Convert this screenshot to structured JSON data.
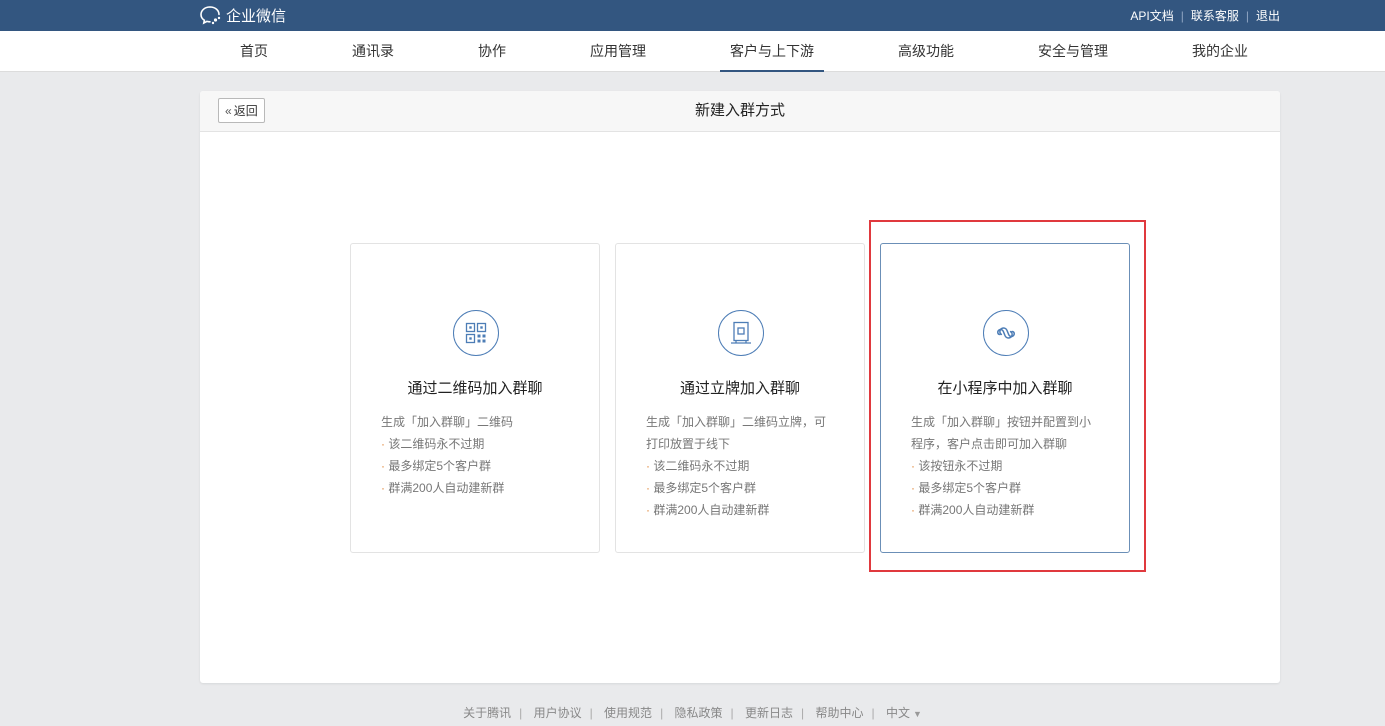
{
  "header": {
    "app_name": "企业微信",
    "links": [
      "API文档",
      "联系客服",
      "退出"
    ]
  },
  "nav": {
    "items": [
      "首页",
      "通讯录",
      "协作",
      "应用管理",
      "客户与上下游",
      "高级功能",
      "安全与管理",
      "我的企业"
    ],
    "active": "客户与上下游"
  },
  "panel": {
    "back_label": "返回",
    "title": "新建入群方式"
  },
  "cards": [
    {
      "title": "通过二维码加入群聊",
      "intro": [
        "生成「加入群聊」二维码"
      ],
      "bullets": [
        "该二维码永不过期",
        "最多绑定5个客户群",
        "群满200人自动建新群"
      ]
    },
    {
      "title": "通过立牌加入群聊",
      "intro": [
        "生成「加入群聊」二维码立牌，可",
        "打印放置于线下"
      ],
      "bullets": [
        "该二维码永不过期",
        "最多绑定5个客户群",
        "群满200人自动建新群"
      ]
    },
    {
      "title": "在小程序中加入群聊",
      "intro": [
        "生成「加入群聊」按钮并配置到小",
        "程序，客户点击即可加入群聊"
      ],
      "bullets": [
        "该按钮永不过期",
        "最多绑定5个客户群",
        "群满200人自动建新群"
      ]
    }
  ],
  "footer": {
    "links": [
      "关于腾讯",
      "用户协议",
      "使用规范",
      "隐私政策",
      "更新日志",
      "帮助中心"
    ],
    "language": "中文"
  },
  "colors": {
    "topbar": "#335680",
    "accent": "#4d7db6",
    "highlight": "#e0393e"
  }
}
